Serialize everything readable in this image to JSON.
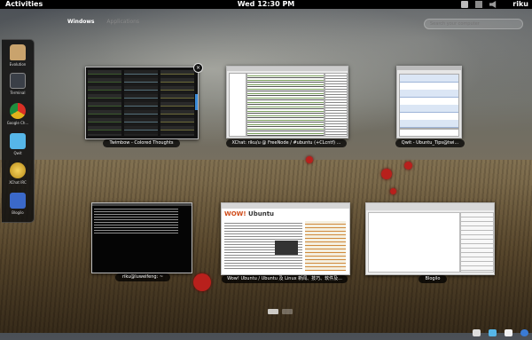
{
  "top_panel": {
    "activities": "Activities",
    "clock": "Wed 12:30 PM",
    "user": "riku"
  },
  "header": {
    "tab_windows": "Windows",
    "tab_applications": "Applications",
    "search_placeholder": "Search your computer"
  },
  "dash": {
    "items": [
      {
        "label": "Evolution",
        "icon": "mail-icon",
        "color": "#c9a36d"
      },
      {
        "label": "Terminal",
        "icon": "terminal-icon",
        "color": "#3a3f47"
      },
      {
        "label": "Google Ch...",
        "icon": "chrome-icon",
        "color": "#e3b21c"
      },
      {
        "label": "Qwit",
        "icon": "twitter-icon",
        "color": "#56b6e8"
      },
      {
        "label": "XChat IRC",
        "icon": "irc-icon",
        "color": "#e0b531"
      },
      {
        "label": "Blogilo",
        "icon": "blog-icon",
        "color": "#3b69c9"
      }
    ]
  },
  "windows": [
    {
      "label": "Twimbow - Colored Thoughts"
    },
    {
      "label": "XChat: riku/u @ FreeNode / #ubuntu (+CLcntf) ..."
    },
    {
      "label": "Qwit - Ubuntu_Tips@twi..."
    },
    {
      "label": "riku@luweifeng: ~"
    },
    {
      "label": "Wow! Ubuntu / Ubuntu 及 Linux 新闻、技巧、软件及..."
    },
    {
      "label": "Blogilo"
    }
  ],
  "browser_logo": {
    "wow": "WOW!",
    "ubuntu": "Ubuntu"
  }
}
